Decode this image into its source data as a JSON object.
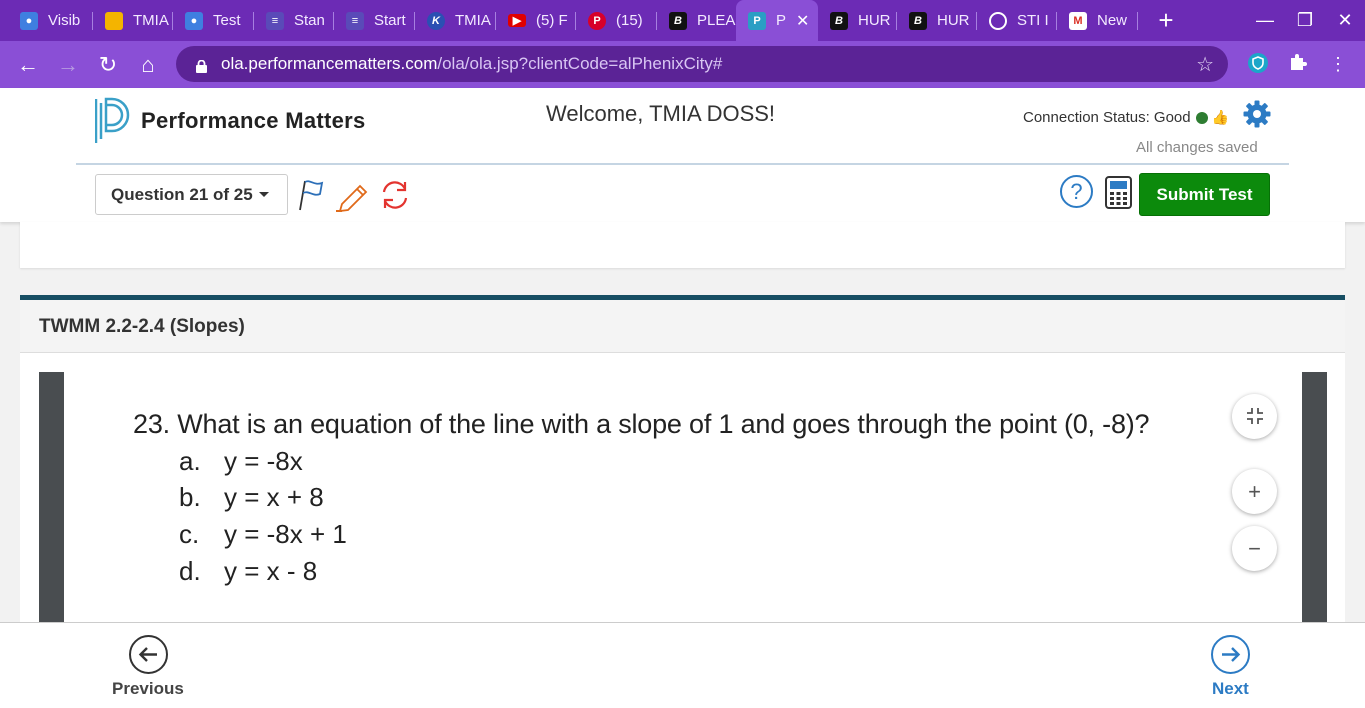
{
  "browser": {
    "tabs": [
      {
        "label": "Visib",
        "icon": "person-icon",
        "color": "#3f7fe0"
      },
      {
        "label": "TMIA",
        "icon": "slides-icon",
        "color": "#f4b400"
      },
      {
        "label": "Test",
        "icon": "person-icon",
        "color": "#3f7fe0"
      },
      {
        "label": "Stan",
        "icon": "list-icon",
        "color": "#5a4ab8"
      },
      {
        "label": "Start",
        "icon": "list-icon",
        "color": "#5a4ab8"
      },
      {
        "label": "TMIA",
        "icon": "k-icon",
        "color": "#2b4fb3"
      },
      {
        "label": "(5) F",
        "icon": "youtube-icon",
        "color": "#e00000"
      },
      {
        "label": "(15)",
        "icon": "pinterest-icon",
        "color": "#d7002a"
      },
      {
        "label": "PLEA",
        "icon": "b-icon",
        "color": "#111111"
      },
      {
        "label": "P",
        "icon": "performance-matters-icon",
        "color": "#2a9ec4"
      },
      {
        "label": "HUR",
        "icon": "b-icon",
        "color": "#111111"
      },
      {
        "label": "HUR",
        "icon": "b-icon",
        "color": "#111111"
      },
      {
        "label": "STI I",
        "icon": "globe-icon",
        "color": "#ffffff"
      },
      {
        "label": "New",
        "icon": "gmail-icon",
        "color": "#d93025"
      }
    ],
    "url_host": "ola.performancematters.com",
    "url_path": "/ola/ola.jsp?clientCode=alPhenixCity#"
  },
  "header": {
    "logo_text": "Performance Matters",
    "welcome": "Welcome, TMIA DOSS!",
    "connection_status": "Connection Status: Good",
    "saved_status": "All changes saved"
  },
  "toolbar": {
    "question_selector": "Question 21 of 25",
    "help_label": "?",
    "submit_label": "Submit Test"
  },
  "question": {
    "section_title": "TWMM 2.2-2.4 (Slopes)",
    "text": "23. What is an equation of the line with a slope of 1 and goes through the point (0, -8)?",
    "options": [
      {
        "letter": "a.",
        "text": "y = -8x"
      },
      {
        "letter": "b.",
        "text": "y = x + 8"
      },
      {
        "letter": "c.",
        "text": "y = -8x + 1"
      },
      {
        "letter": "d.",
        "text": "y = x - 8"
      }
    ]
  },
  "footer": {
    "previous_label": "Previous",
    "next_label": "Next"
  },
  "colors": {
    "chrome_purple": "#6c2bb5",
    "submit_green": "#0c8a0c",
    "accent_blue": "#2c7bc4",
    "card_border": "#174e63"
  }
}
